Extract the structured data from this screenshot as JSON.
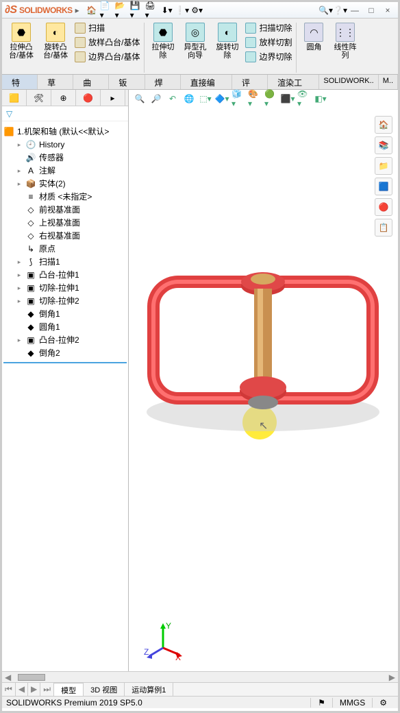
{
  "app": {
    "name": "SOLIDWORKS"
  },
  "title_icons": [
    "home-icon",
    "doc-icon",
    "open-icon",
    "save-icon",
    "print-icon",
    "undo-icon",
    "settings-icon",
    "help-icon",
    "search-icon"
  ],
  "win": {
    "min": "—",
    "max": "□",
    "close": "×"
  },
  "ribbon": {
    "big": [
      {
        "label": "拉伸凸\n台/基体",
        "name": "extrude-boss"
      },
      {
        "label": "旋转凸\n台/基体",
        "name": "revolve-boss"
      }
    ],
    "list1": [
      {
        "label": "扫描",
        "name": "sweep"
      },
      {
        "label": "放样凸台/基体",
        "name": "loft-boss"
      },
      {
        "label": "边界凸台/基体",
        "name": "boundary-boss"
      }
    ],
    "big2": [
      {
        "label": "拉伸切\n除",
        "name": "extrude-cut"
      },
      {
        "label": "异型孔\n向导",
        "name": "hole-wizard"
      },
      {
        "label": "旋转切\n除",
        "name": "revolve-cut"
      }
    ],
    "list2": [
      {
        "label": "扫描切除",
        "name": "sweep-cut"
      },
      {
        "label": "放样切割",
        "name": "loft-cut"
      },
      {
        "label": "边界切除",
        "name": "boundary-cut"
      }
    ],
    "big3": [
      {
        "label": "圆角",
        "name": "fillet"
      },
      {
        "label": "线性阵\n列",
        "name": "linear-pattern"
      }
    ]
  },
  "tabs": [
    "特征",
    "草图",
    "曲面",
    "钣金",
    "焊件",
    "直接编辑",
    "评估",
    "渲染工具",
    "SOLIDWORK..",
    "M.."
  ],
  "active_tab": 0,
  "tree": {
    "root": "1.机架和轴  (默认<<默认>",
    "items": [
      {
        "icon": "🕘",
        "label": "History",
        "exp": true
      },
      {
        "icon": "🔊",
        "label": "传感器"
      },
      {
        "icon": "A",
        "label": "注解",
        "exp": true
      },
      {
        "icon": "📦",
        "label": "实体(2)",
        "exp": true
      },
      {
        "icon": "≡",
        "label": "材质 <未指定>"
      },
      {
        "icon": "◇",
        "label": "前视基准面"
      },
      {
        "icon": "◇",
        "label": "上视基准面"
      },
      {
        "icon": "◇",
        "label": "右视基准面"
      },
      {
        "icon": "↳",
        "label": "原点"
      },
      {
        "icon": "⟆",
        "label": "扫描1",
        "exp": true
      },
      {
        "icon": "▣",
        "label": "凸台-拉伸1",
        "exp": true
      },
      {
        "icon": "▣",
        "label": "切除-拉伸1",
        "exp": true
      },
      {
        "icon": "▣",
        "label": "切除-拉伸2",
        "exp": true
      },
      {
        "icon": "◆",
        "label": "倒角1"
      },
      {
        "icon": "◆",
        "label": "圆角1"
      },
      {
        "icon": "▣",
        "label": "凸台-拉伸2",
        "exp": true
      },
      {
        "icon": "◆",
        "label": "倒角2"
      }
    ]
  },
  "bottom_tabs": [
    "模型",
    "3D 视图",
    "运动算例1"
  ],
  "active_bottom_tab": 0,
  "status": {
    "text": "SOLIDWORKS Premium 2019 SP5.0",
    "units": "MMGS"
  },
  "triad": {
    "x": "X",
    "y": "Y",
    "z": "Z"
  }
}
